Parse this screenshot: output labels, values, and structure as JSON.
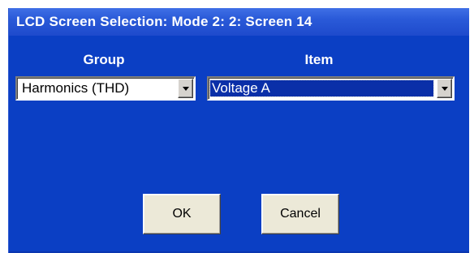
{
  "dialog": {
    "title": "LCD Screen Selection: Mode 2: 2: Screen 14"
  },
  "group": {
    "label": "Group",
    "selected": "Harmonics (THD)",
    "icon": "chevron-down-icon"
  },
  "item": {
    "label": "Item",
    "selected": "Voltage A",
    "icon": "chevron-down-icon"
  },
  "buttons": {
    "ok_label": "OK",
    "cancel_label": "Cancel"
  },
  "colors": {
    "background": "#0b3fc4",
    "titlebar": "#2a5ad8",
    "selection": "#0a2fa8",
    "button_face": "#ece9d8"
  }
}
